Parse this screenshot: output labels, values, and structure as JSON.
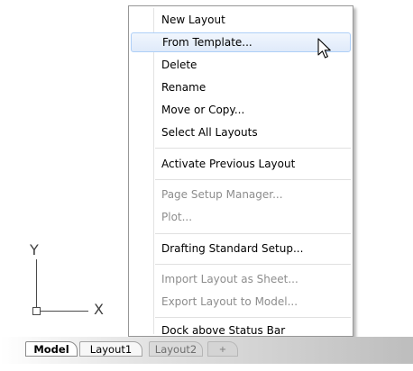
{
  "menu": {
    "items": [
      {
        "label": "New Layout",
        "enabled": true
      },
      {
        "label": "From Template...",
        "enabled": true,
        "highlighted": true
      },
      {
        "label": "Delete",
        "enabled": true
      },
      {
        "label": "Rename",
        "enabled": true
      },
      {
        "label": "Move or Copy...",
        "enabled": true
      },
      {
        "label": "Select All Layouts",
        "enabled": true
      },
      {
        "label": "Activate Previous Layout",
        "enabled": true
      },
      {
        "label": "Page Setup Manager...",
        "enabled": false
      },
      {
        "label": "Plot...",
        "enabled": false
      },
      {
        "label": "Drafting Standard Setup...",
        "enabled": true
      },
      {
        "label": "Import Layout as Sheet...",
        "enabled": false
      },
      {
        "label": "Export Layout to Model...",
        "enabled": false
      },
      {
        "label": "Dock above Status Bar",
        "enabled": true
      }
    ]
  },
  "ucs": {
    "x_label": "X",
    "y_label": "Y"
  },
  "tabs": [
    {
      "label": "Model",
      "active": true
    },
    {
      "label": "Layout1",
      "active": false
    },
    {
      "label": "Layout2",
      "active": false
    },
    {
      "label": "+",
      "icon": "add-tab-icon"
    }
  ],
  "colors": {
    "menu_highlight": "#dfeafa",
    "disabled_text": "#8d8d8d"
  }
}
